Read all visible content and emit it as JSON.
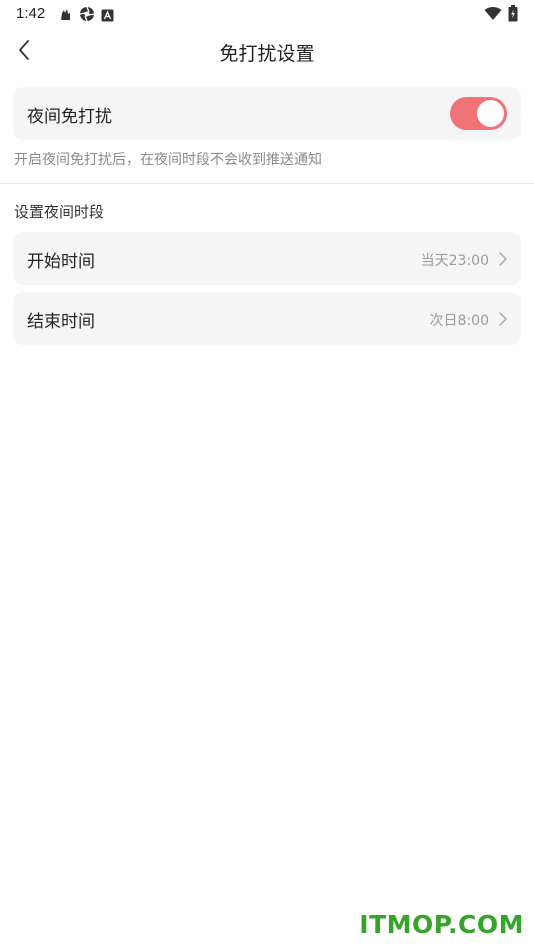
{
  "status_bar": {
    "time": "1:42",
    "left_icons": [
      "notification-icon",
      "aperture-icon",
      "a-square-icon"
    ],
    "right_icons": [
      "wifi-icon",
      "battery-icon"
    ]
  },
  "header": {
    "title": "免打扰设置",
    "back_icon": "chevron-left-icon"
  },
  "night_mode": {
    "label": "夜间免打扰",
    "enabled": true,
    "hint": "开启夜间免打扰后，在夜间时段不会收到推送通知"
  },
  "time_section": {
    "title": "设置夜间时段",
    "items": [
      {
        "label": "开始时间",
        "value": "当天23:00"
      },
      {
        "label": "结束时间",
        "value": "次日8:00"
      }
    ]
  },
  "watermark": "ITMOP.COM",
  "colors": {
    "accent": "#f07377",
    "card_bg": "#f5f5f5",
    "watermark": "#35a52a"
  }
}
